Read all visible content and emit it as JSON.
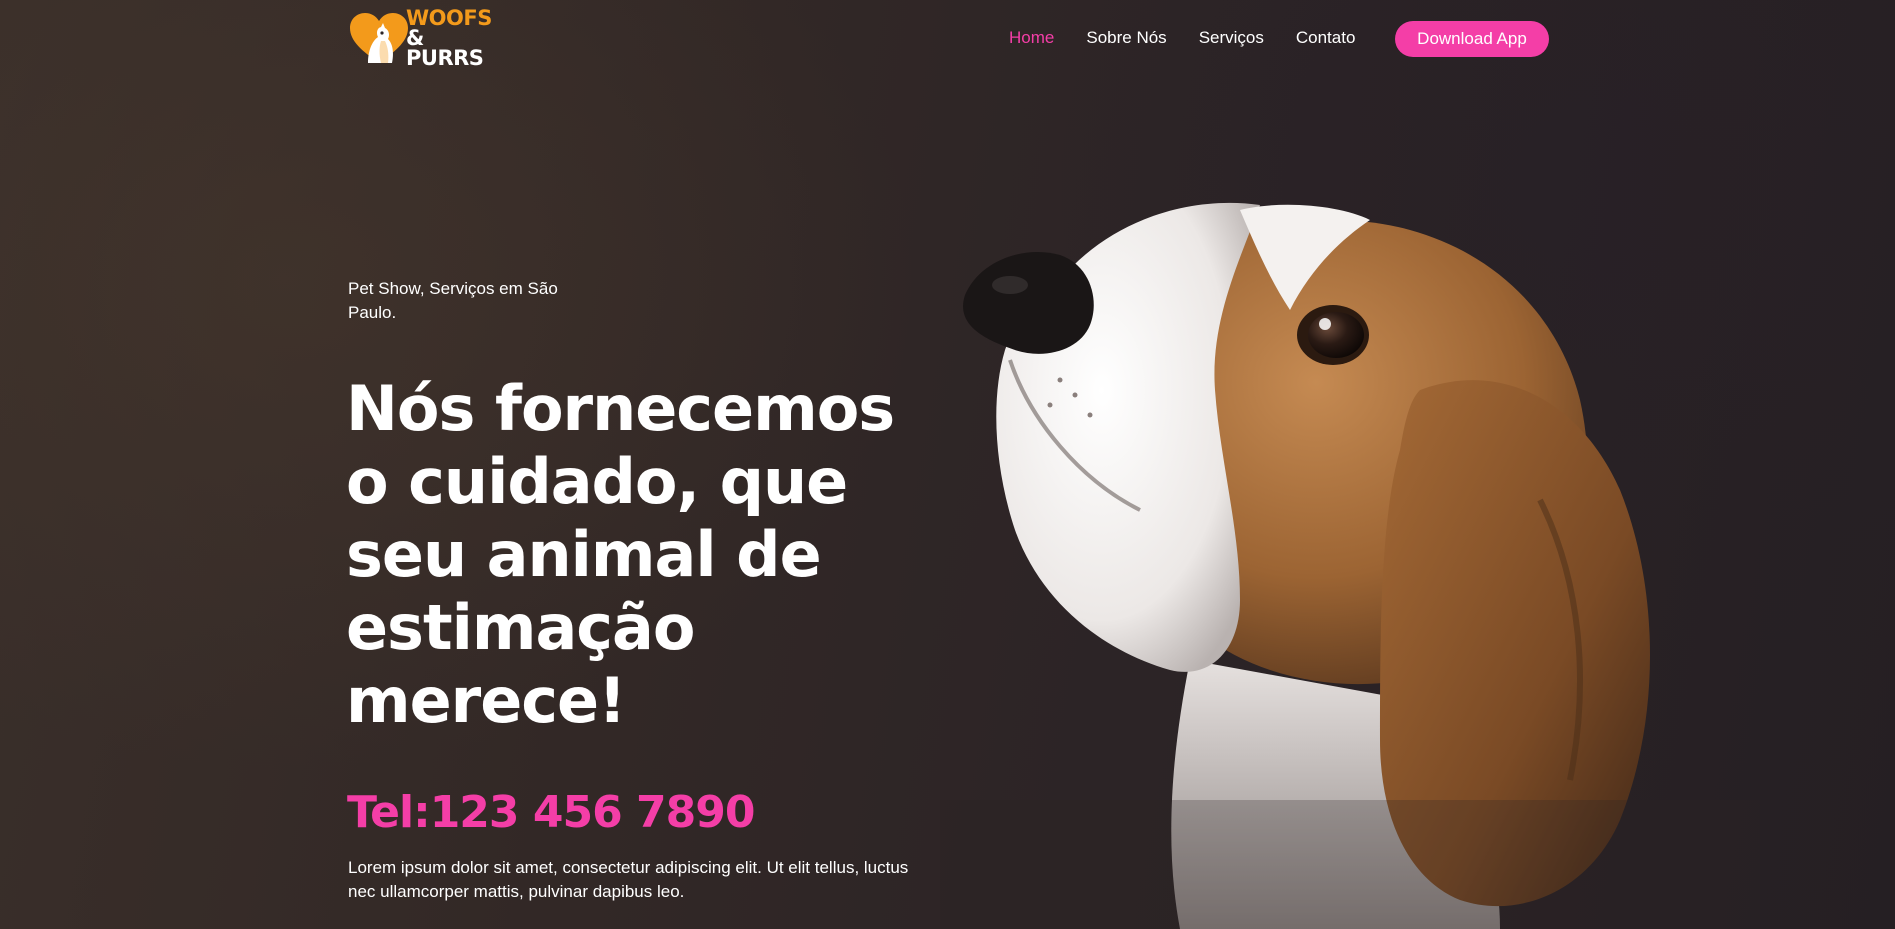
{
  "brand": {
    "line1": "WOOFS",
    "line2": "& PURRS",
    "icon": "heart-pet-icon",
    "colors": {
      "orange": "#f39a1b",
      "white": "#ffffff"
    }
  },
  "nav": {
    "items": [
      {
        "label": "Home",
        "active": true
      },
      {
        "label": "Sobre Nós",
        "active": false
      },
      {
        "label": "Serviços",
        "active": false
      },
      {
        "label": "Contato",
        "active": false
      }
    ]
  },
  "cta": {
    "label": "Download App"
  },
  "hero": {
    "tagline": "Pet Show, Serviços em São Paulo.",
    "headline": "Nós fornecemos o cuidado, que seu animal de estimação merece!",
    "phone": "Tel:123 456 7890",
    "description": "Lorem ipsum dolor sit amet, consectetur adipiscing elit. Ut elit tellus, luctus nec ullamcorper mattis, pulvinar dapibus leo.",
    "image": "beagle-puppy-photo"
  },
  "colors": {
    "accent": "#f43ea7",
    "background": "#2e2627",
    "text": "#ffffff"
  }
}
